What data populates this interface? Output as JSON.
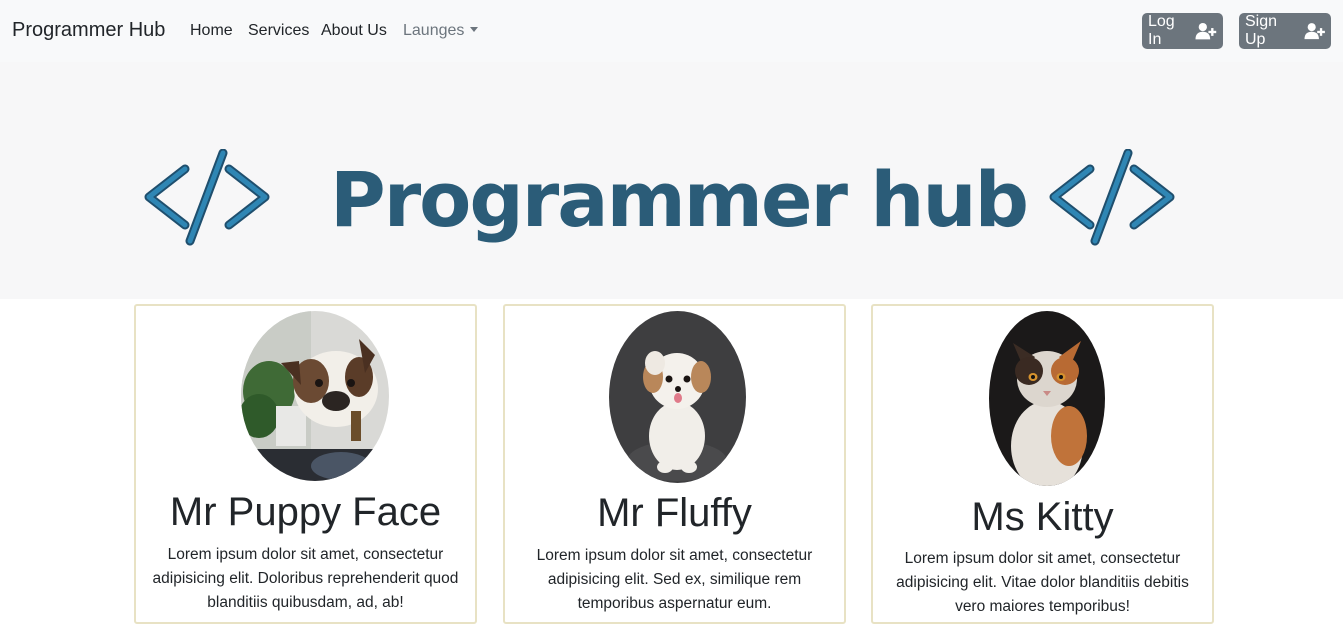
{
  "navbar": {
    "brand": "Programmer Hub",
    "links": [
      "Home",
      "Services",
      "About Us"
    ],
    "dropdown": "Launges",
    "login_label": "Log In",
    "signup_label": "Sign Up"
  },
  "hero": {
    "title": "Programmer hub",
    "icon_color": "#2f7ea8",
    "title_color": "#2b5c78"
  },
  "cards": [
    {
      "name": "Mr Puppy Face",
      "text": "Lorem ipsum dolor sit amet, consectetur adipisicing elit. Doloribus reprehenderit quod blanditiis quibusdam, ad, ab!",
      "photo": "french-bulldog-photo"
    },
    {
      "name": "Mr Fluffy",
      "text": "Lorem ipsum dolor sit amet, consectetur adipisicing elit. Sed ex, similique rem temporibus aspernatur eum.",
      "photo": "white-fluffy-dog-photo"
    },
    {
      "name": "Ms Kitty",
      "text": "Lorem ipsum dolor sit amet, consectetur adipisicing elit. Vitae dolor blanditiis debitis vero maiores temporibus!",
      "photo": "calico-cat-photo"
    }
  ]
}
